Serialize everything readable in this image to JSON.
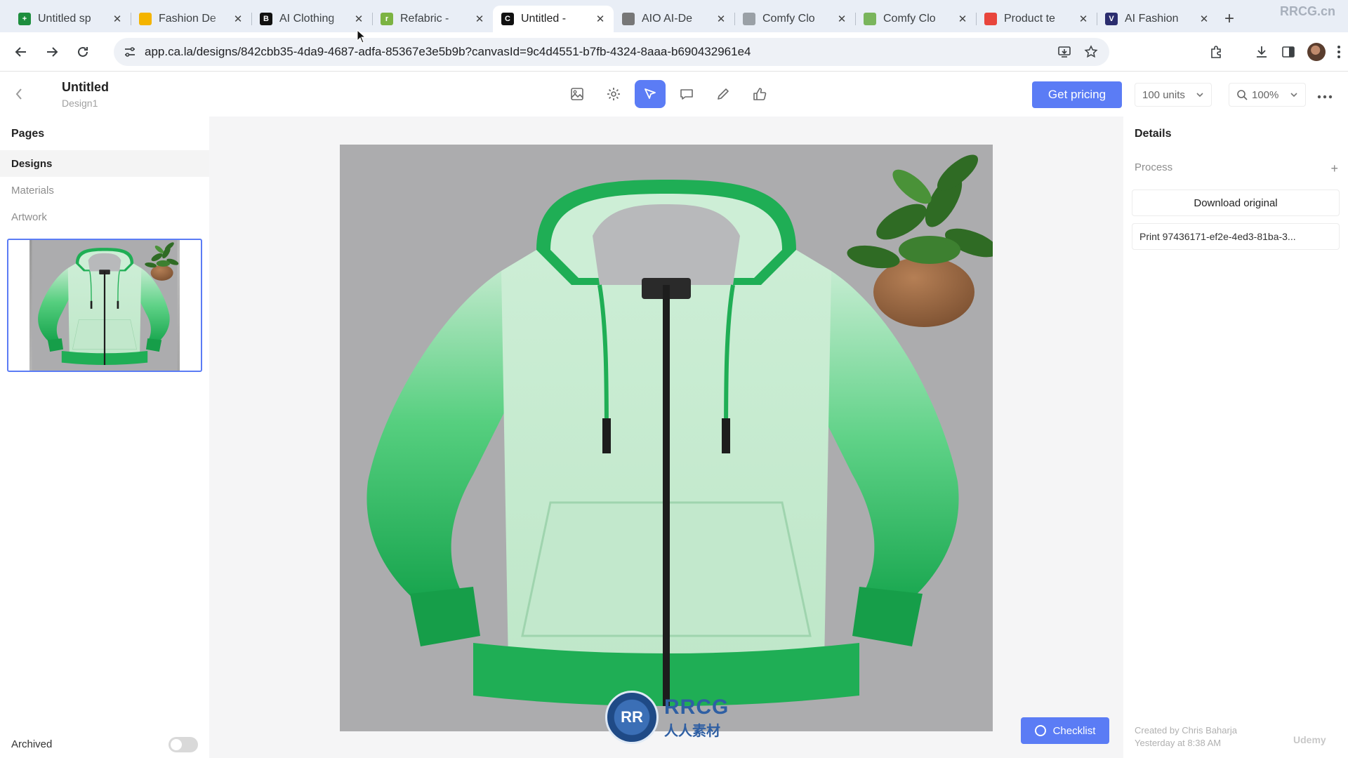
{
  "browser": {
    "tabs": [
      {
        "title": "Untitled sp",
        "icon": "sheets-icon",
        "color": "#1e8e3e",
        "glyph": "+"
      },
      {
        "title": "Fashion De",
        "icon": "slides-icon",
        "color": "#f4b400",
        "glyph": ""
      },
      {
        "title": "AI Clothing",
        "icon": "aiclothing-icon",
        "color": "#111111",
        "glyph": "B"
      },
      {
        "title": "Refabric -",
        "icon": "refabric-icon",
        "color": "#7cb342",
        "glyph": "r"
      },
      {
        "title": "Untitled -",
        "icon": "calla-icon",
        "color": "#111111",
        "glyph": "C",
        "active": true
      },
      {
        "title": "AIO AI-De",
        "icon": "aio-icon",
        "color": "#777777",
        "glyph": ""
      },
      {
        "title": "Comfy Clo",
        "icon": "globe-icon",
        "color": "#9aa0a6",
        "glyph": ""
      },
      {
        "title": "Comfy Clo",
        "icon": "shopify-icon",
        "color": "#7ab55c",
        "glyph": ""
      },
      {
        "title": "Product te",
        "icon": "product-icon",
        "color": "#e8453c",
        "glyph": ""
      },
      {
        "title": "AI Fashion",
        "icon": "aifashion-icon",
        "color": "#2b2d6e",
        "glyph": "V"
      }
    ],
    "url": "app.ca.la/designs/842cbb35-4da9-4687-adfa-85367e3e5b9b?canvasId=9c4d4551-b7fb-4324-8aaa-b690432961e4"
  },
  "header": {
    "title": "Untitled",
    "subtitle": "Design1",
    "pricing_label": "Get pricing",
    "units_label": "100 units",
    "zoom_label": "100%"
  },
  "sidebar": {
    "heading": "Pages",
    "items": [
      {
        "label": "Designs",
        "selected": true
      },
      {
        "label": "Materials"
      },
      {
        "label": "Artwork"
      }
    ],
    "archived_label": "Archived"
  },
  "canvas": {
    "checklist_label": "Checklist"
  },
  "details": {
    "heading": "Details",
    "process_label": "Process",
    "download_label": "Download original",
    "print_label": "Print 97436171-ef2e-4ed3-81ba-3...",
    "created_line1": "Created by Chris Baharja",
    "created_line2": "Yesterday at 8:38 AM"
  },
  "overlays": {
    "watermark_brand": "RRCG",
    "watermark_sub": "人人素材",
    "corner_brand": "RRCG.cn",
    "udemy": "Udemy"
  },
  "colors": {
    "accent": "#5b7cf5",
    "hoodie_light": "#c6ecd0",
    "hoodie_green": "#1fae55"
  }
}
